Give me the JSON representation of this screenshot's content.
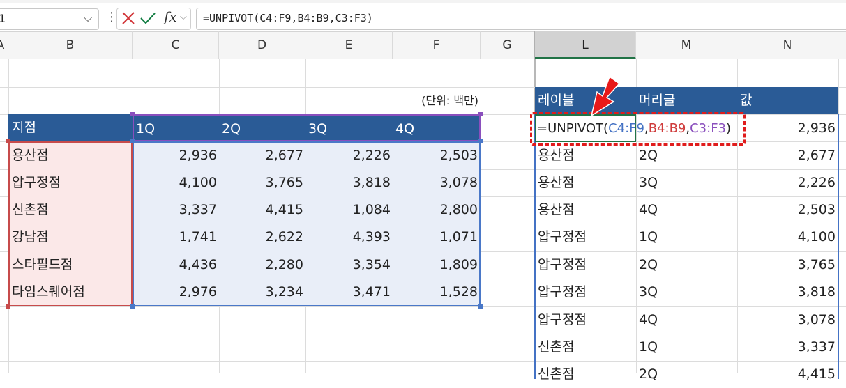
{
  "formula_bar": {
    "name_box": "1",
    "fx_label": "fx",
    "formula": "=UNPIVOT(C4:F9,B4:B9,C3:F3)"
  },
  "columns": [
    "A",
    "B",
    "C",
    "D",
    "E",
    "F",
    "G",
    "L",
    "M",
    "N"
  ],
  "left_table": {
    "unit_note": "(단위: 백만)",
    "header": [
      "지점",
      "1Q",
      "2Q",
      "3Q",
      "4Q"
    ],
    "rows": [
      {
        "label": "용산점",
        "values": [
          "2,936",
          "2,677",
          "2,226",
          "2,503"
        ]
      },
      {
        "label": "압구정점",
        "values": [
          "4,100",
          "3,765",
          "3,818",
          "3,078"
        ]
      },
      {
        "label": "신촌점",
        "values": [
          "3,337",
          "4,415",
          "1,084",
          "2,800"
        ]
      },
      {
        "label": "강남점",
        "values": [
          "1,741",
          "2,622",
          "4,393",
          "1,071"
        ]
      },
      {
        "label": "스타필드점",
        "values": [
          "4,436",
          "2,280",
          "3,354",
          "1,809"
        ]
      },
      {
        "label": "타임스퀘어점",
        "values": [
          "2,976",
          "3,234",
          "3,471",
          "1,528"
        ]
      }
    ]
  },
  "right_table": {
    "header": [
      "레이블",
      "머리글",
      "값"
    ],
    "formula_cell": {
      "prefix": "=UNPIVOT(",
      "arg1": "C4:F9",
      "sep1": ",",
      "arg2": "B4:B9",
      "sep2": ",",
      "arg3": "C3:F3",
      "suffix": ")"
    },
    "first_value": "2,936",
    "rows": [
      {
        "label": "용산점",
        "header": "2Q",
        "value": "2,677"
      },
      {
        "label": "용산점",
        "header": "3Q",
        "value": "2,226"
      },
      {
        "label": "용산점",
        "header": "4Q",
        "value": "2,503"
      },
      {
        "label": "압구정점",
        "header": "1Q",
        "value": "4,100"
      },
      {
        "label": "압구정점",
        "header": "2Q",
        "value": "3,765"
      },
      {
        "label": "압구정점",
        "header": "3Q",
        "value": "3,818"
      },
      {
        "label": "압구정점",
        "header": "4Q",
        "value": "3,078"
      },
      {
        "label": "신촌점",
        "header": "1Q",
        "value": "3,337"
      },
      {
        "label": "신촌점",
        "header": "2Q",
        "value": "4,415"
      }
    ]
  },
  "colors": {
    "header_blue": "#2a5b96",
    "red_ref": "#cf3b3b",
    "blue_ref": "#4472c4",
    "purple_ref": "#8a4fbd",
    "arrow_red": "#e81919"
  }
}
